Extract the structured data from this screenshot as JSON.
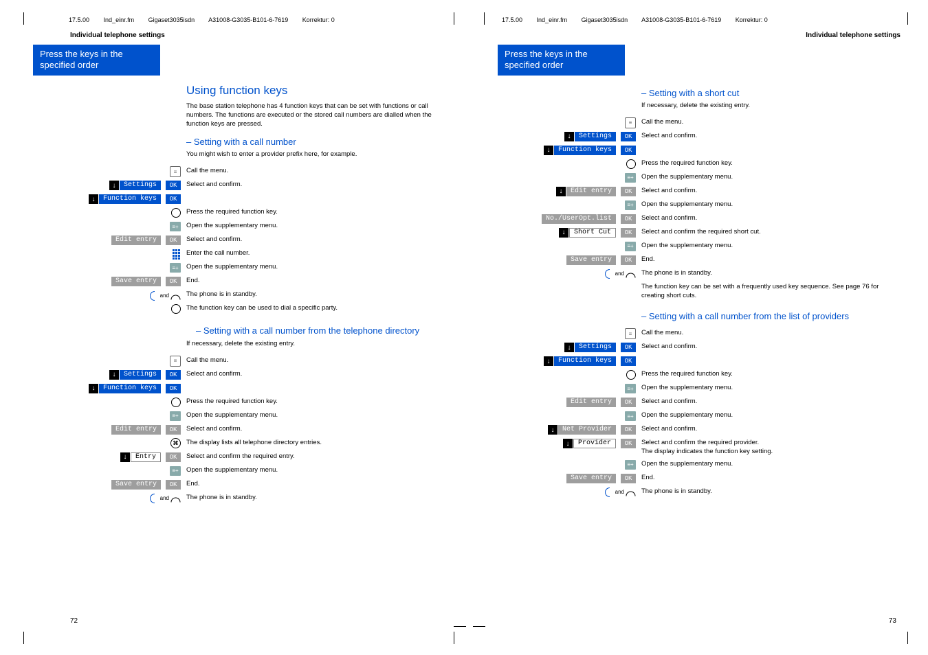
{
  "doc_header": {
    "date": "17.5.00",
    "file": "Ind_einr.fm",
    "product": "Gigaset3035isdn",
    "partno": "A31008-G3035-B101-6-7619",
    "korrektur": "Korrektur: 0"
  },
  "section_title": "Individual telephone settings",
  "banner": "Press the keys in the specified order",
  "ok_label": "OK",
  "and_label": "and",
  "left_page": {
    "number": "72",
    "h_main": "Using function keys",
    "intro": "The base station telephone has 4 function keys that can be set with functions or call numbers. The functions are executed or the stored call numbers are dialled when the function keys are pressed.",
    "sec1": {
      "title": "– Setting with a call number",
      "note": "You might wish to enter a provider prefix here, for example.",
      "steps": {
        "call_menu": "Call the menu.",
        "select_confirm": "Select and confirm.",
        "press_fn": "Press the required function key.",
        "open_supp": "Open the supplementary menu.",
        "enter_no": "Enter the call number.",
        "end": "End.",
        "standby": "The phone is in standby.",
        "fn_note": "The function key can be used to dial a specific party."
      },
      "labels": {
        "settings": "Settings",
        "fnkeys": "Function keys",
        "edit": "Edit entry",
        "save": "Save entry"
      }
    },
    "sec2": {
      "title": "– Setting with a call number from the telephone directory",
      "note": "If necessary, delete the existing entry.",
      "steps": {
        "call_menu": "Call the menu.",
        "select_confirm": "Select and confirm.",
        "press_fn": "Press the required function key.",
        "open_supp": "Open the supplementary menu.",
        "list_entries": "The display lists all telephone directory entries.",
        "select_entry": "Select and confirm the required entry.",
        "end": "End.",
        "standby": "The phone is in standby."
      },
      "labels": {
        "settings": "Settings",
        "fnkeys": "Function keys",
        "edit": "Edit entry",
        "entry": "Entry",
        "save": "Save entry"
      }
    }
  },
  "right_page": {
    "number": "73",
    "sec1": {
      "title": "– Setting with a short cut",
      "note": "If necessary, delete the existing entry.",
      "steps": {
        "call_menu": "Call the menu.",
        "select_confirm": "Select and confirm.",
        "press_fn": "Press the required function key.",
        "open_supp": "Open the supplementary menu.",
        "select_short": "Select and confirm the required short cut.",
        "end": "End.",
        "standby": "The phone is in standby.",
        "fn_note": "The function key can be set with a frequently used key sequence. See page 76 for creating short cuts."
      },
      "labels": {
        "settings": "Settings",
        "fnkeys": "Function keys",
        "edit": "Edit entry",
        "nouser": "No./UserOpt.list",
        "shortcut": "Short Cut",
        "save": "Save entry"
      }
    },
    "sec2": {
      "title": "– Setting with a call number from the list of providers",
      "steps": {
        "call_menu": "Call the menu.",
        "select_confirm": "Select and confirm.",
        "press_fn": "Press the required function key.",
        "open_supp": "Open the supplementary menu.",
        "select_prov": "Select and confirm the required provider.\nThe display indicates the function key setting.",
        "end": "End.",
        "standby": "The phone is in standby."
      },
      "labels": {
        "settings": "Settings",
        "fnkeys": "Function keys",
        "edit": "Edit entry",
        "netprov": "Net Provider",
        "provider": "Provider",
        "save": "Save entry"
      }
    }
  }
}
